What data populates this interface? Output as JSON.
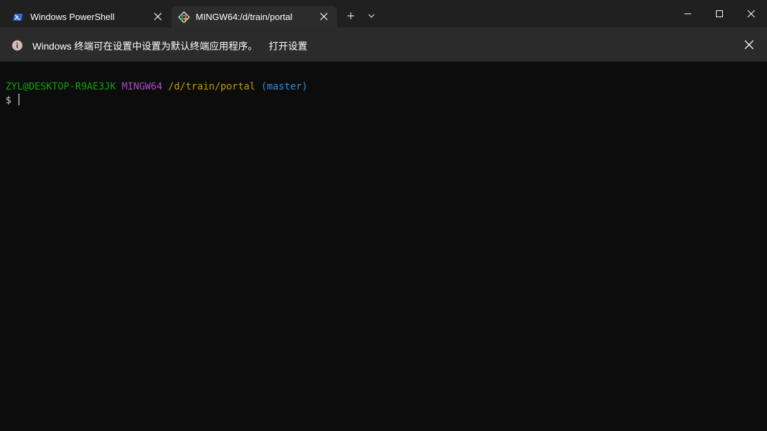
{
  "tabs": [
    {
      "title": "Windows PowerShell",
      "icon": "powershell-icon",
      "active": false
    },
    {
      "title": "MINGW64:/d/train/portal",
      "icon": "git-icon",
      "active": true
    }
  ],
  "tab_actions": {
    "new_tab_icon": "plus-icon",
    "dropdown_icon": "chevron-down-icon"
  },
  "window_controls": [
    "minimize-icon",
    "maximize-icon",
    "close-icon"
  ],
  "infobar": {
    "message": "Windows 终端可在设置中设置为默认终端应用程序。",
    "link": "打开设置",
    "icon": "info-icon"
  },
  "terminal": {
    "user_host": "ZYL@DESKTOP-R9AE3JK",
    "system": "MINGW64",
    "path": "/d/train/portal",
    "branch": "(master)",
    "prompt": "$"
  },
  "colors": {
    "background": "#0c0c0c",
    "tabbar": "#202020",
    "active_tab": "#2c2c2c",
    "infobar": "#2b2b2b",
    "user_host": "#13a10e",
    "system": "#b148c6",
    "path": "#c19c00",
    "branch": "#2f8fdd"
  }
}
